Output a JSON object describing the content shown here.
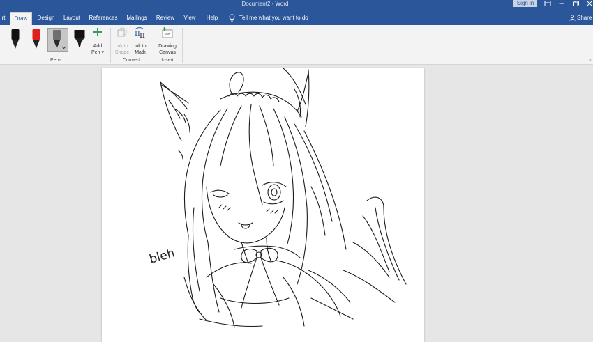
{
  "titlebar": {
    "title": "Document2  -  Word",
    "sign_in": "Sign in"
  },
  "tabs": [
    {
      "label": "rt"
    },
    {
      "label": "Draw"
    },
    {
      "label": "Design"
    },
    {
      "label": "Layout"
    },
    {
      "label": "References"
    },
    {
      "label": "Mailings"
    },
    {
      "label": "Review"
    },
    {
      "label": "View"
    },
    {
      "label": "Help"
    }
  ],
  "tell_me": "Tell me what you want to do",
  "share": "Share",
  "ribbon": {
    "groups": {
      "pens": "Pens",
      "convert": "Convert",
      "insert": "Insert"
    },
    "add_pen": {
      "line1": "Add",
      "line2": "Pen"
    },
    "ink_to_shape": {
      "line1": "Ink to",
      "line2": "Shape"
    },
    "ink_to_math": {
      "line1": "Ink to",
      "line2": "Math"
    },
    "drawing_canvas": {
      "line1": "Drawing",
      "line2": "Canvas"
    }
  },
  "pens": [
    {
      "name": "black-pen",
      "color": "#111111"
    },
    {
      "name": "red-pen",
      "color": "#e0201c"
    },
    {
      "name": "pencil",
      "color": "#555555"
    },
    {
      "name": "highlighter",
      "color": "#111111"
    }
  ],
  "document": {
    "ink_text": "bleh"
  }
}
